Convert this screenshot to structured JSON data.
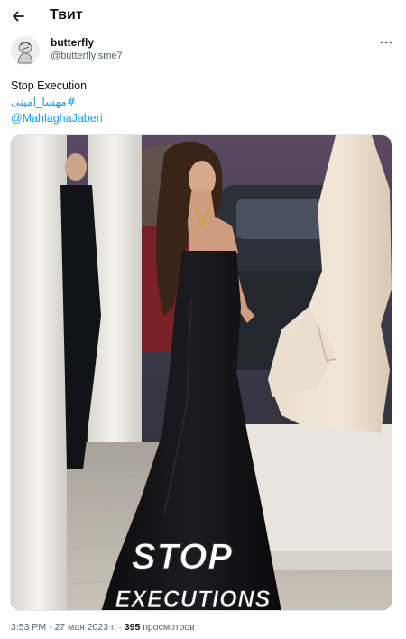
{
  "header": {
    "title": "Твит",
    "back_icon": "arrow-left-icon"
  },
  "author": {
    "name": "butterfly",
    "handle": "@butterflyisme7",
    "avatar_icon": "avatar-sketch-icon",
    "more_icon": "more-horizontal-icon"
  },
  "tweet": {
    "text": "Stop Execution",
    "hashtag": "#مهسا_امینی",
    "mention": "@MahlaghaJaberi"
  },
  "media": {
    "overlay_line1": "STOP",
    "overlay_line2": "EXECUTIONS"
  },
  "meta": {
    "time": "3:53 PM",
    "separator": "·",
    "date": "27 мая 2023 г.",
    "views_count": "395",
    "views_label": "просмотров"
  },
  "colors": {
    "link": "#1d9bf0",
    "secondary_text": "#536471",
    "primary_text": "#0f1419"
  }
}
